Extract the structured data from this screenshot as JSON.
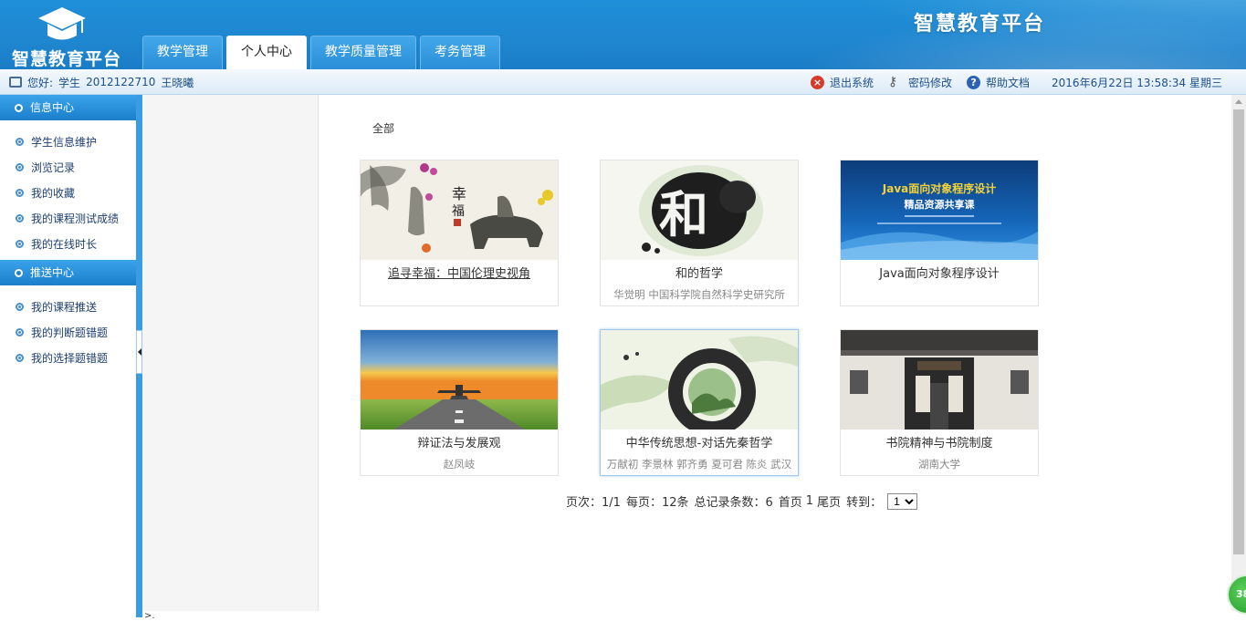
{
  "header": {
    "logo_text": "智慧教育平台",
    "title": "智慧教育平台",
    "tabs": [
      {
        "label": "教学管理",
        "active": false
      },
      {
        "label": "个人中心",
        "active": true
      },
      {
        "label": "教学质量管理",
        "active": false
      },
      {
        "label": "考务管理",
        "active": false
      }
    ]
  },
  "infobar": {
    "greeting": "您好:",
    "role": "学生",
    "student_id": "2012122710",
    "student_name": "王晓曦",
    "logout": "退出系统",
    "change_password": "密码修改",
    "help": "帮助文档",
    "datetime": "2016年6月22日 13:58:34 星期三"
  },
  "sidebar": {
    "sections": [
      {
        "title": "信息中心",
        "items": [
          "学生信息维护",
          "浏览记录",
          "我的收藏",
          "我的课程测试成绩",
          "我的在线时长"
        ]
      },
      {
        "title": "推送中心",
        "items": [
          "我的课程推送",
          "我的判断题错题",
          "我的选择题错题"
        ]
      }
    ]
  },
  "main": {
    "filter_label": "全部",
    "courses": [
      {
        "title": "追寻幸福：中国伦理史视角",
        "subtitle": "",
        "image": "ink-painting-ox"
      },
      {
        "title": "和的哲学",
        "subtitle": "华觉明 中国科学院自然科学史研究所",
        "image": "ink-he-character"
      },
      {
        "title": "Java面向对象程序设计",
        "subtitle": "",
        "image": "java-banner",
        "banner_line1": "Java面向对象程序设计",
        "banner_line2": "精品资源共享课"
      },
      {
        "title": "辩证法与发展观",
        "subtitle": "赵凤岐",
        "image": "airplane-runway"
      },
      {
        "title": "中华传统思想-对话先秦哲学",
        "subtitle": "万献初 李景林 郭齐勇 夏可君 陈炎 武汉",
        "image": "ink-landscape-circle"
      },
      {
        "title": "书院精神与书院制度",
        "subtitle": "湖南大学",
        "image": "academy-gate"
      }
    ],
    "pager": {
      "page_label": "页次：1/1",
      "per_page_label": "每页：12条",
      "total_label": "总记录条数：6",
      "first_label": "首页",
      "page_num": "1",
      "last_label": "尾页",
      "jump_label": "转到：",
      "jump_value": "1"
    }
  },
  "floating_badge": "38",
  "colors": {
    "header_blue": "#1f86d0",
    "sidebar_head": "#1b7fcc",
    "link_blue": "#1d4f8a"
  }
}
